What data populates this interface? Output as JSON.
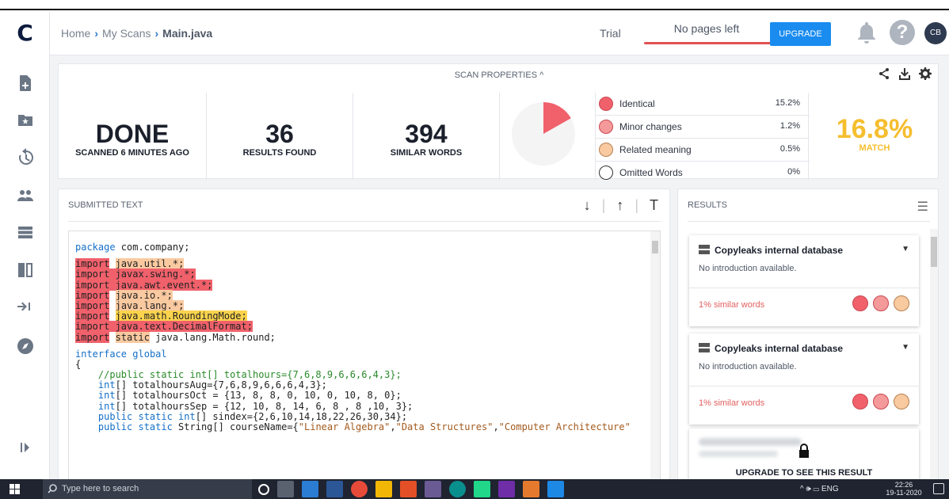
{
  "app": {
    "logo": "C"
  },
  "breadcrumb": {
    "home": "Home",
    "sep": "›",
    "scans": "My Scans",
    "current": "Main.java"
  },
  "header": {
    "trial": "Trial",
    "pages_left": "No pages left",
    "upgrade": "UPGRADE",
    "avatar": "CB",
    "help": "?"
  },
  "sidebar": {
    "items": [
      "new-scan-icon",
      "starred-folder-icon",
      "history-icon",
      "users-icon",
      "list-icon",
      "compare-icon",
      "collapse-icon",
      "explore-icon"
    ],
    "expand": "expand-sidebar-icon"
  },
  "scan_properties": {
    "title": "SCAN PROPERTIES ^",
    "status": "DONE",
    "status_sub": "SCANNED 6 MINUTES AGO",
    "results_count": "36",
    "results_label": "RESULTS FOUND",
    "similar_count": "394",
    "similar_label": "SIMILAR WORDS",
    "match_value": "16.8%",
    "match_label": "MATCH",
    "match_fraction": 0.168,
    "legend": [
      {
        "label": "Identical",
        "value": "15.2%",
        "color": "#f0616b"
      },
      {
        "label": "Minor changes",
        "value": "1.2%",
        "color": "#f59a9a"
      },
      {
        "label": "Related meaning",
        "value": "0.5%",
        "color": "#f9c9a0"
      },
      {
        "label": "Omitted Words",
        "value": "0%",
        "color": "#ffffff"
      }
    ]
  },
  "submitted": {
    "title": "SUBMITTED TEXT",
    "tools": [
      "↓",
      "↑",
      "T"
    ],
    "code": [
      "package com.company;",
      "import java.util.*;",
      "import javax.swing.*;",
      "import java.awt.event.*;",
      "import java.io.*;",
      "import java.lang.*;",
      "import java.math.RoundingMode;",
      "import java.text.DecimalFormat;",
      "import static java.lang.Math.round;",
      "interface global",
      "{",
      "    //public static int[] totalhours={7,6,8,9,6,6,6,4,3};",
      "    int[] totalhoursAug={7,6,8,9,6,6,6,4,3};",
      "    int[] totalhoursOct = {13, 8, 8, 0, 10, 0, 10, 8, 0};",
      "    int[] totalhoursSep = {12, 10, 8, 14, 6, 8 , 8 ,10, 3};",
      "    public static int[] sindex={2,6,10,14,18,22,26,30,34};",
      "    public static String[] courseName={\"Linear Algebra\",\"Data Structures\",\"Computer Architecture\""
    ]
  },
  "results": {
    "title": "RESULTS",
    "cards": [
      {
        "source": "Copyleaks internal database",
        "intro": "No introduction available.",
        "similar": "1% similar words"
      },
      {
        "source": "Copyleaks internal database",
        "intro": "No introduction available.",
        "similar": "1% similar words"
      }
    ],
    "locked": "UPGRADE TO SEE THIS RESULT"
  },
  "taskbar": {
    "search": "Type here to search",
    "tray": "^ 🕪 ▭ ENG",
    "time": "22:26",
    "date": "19-11-2020"
  }
}
